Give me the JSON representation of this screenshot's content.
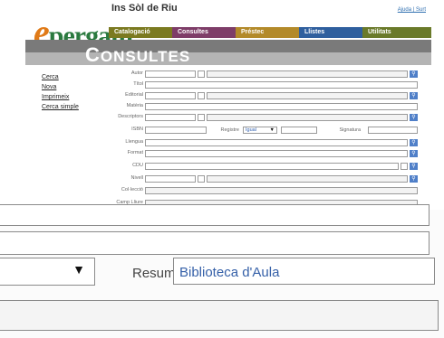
{
  "header": {
    "logo_text": "pergam",
    "logo_letter": "e",
    "school": "Ins Sòl de Riu",
    "links": "Ajuda | Surt"
  },
  "menu": [
    {
      "label": "Catalogació",
      "color": "#7b7a20"
    },
    {
      "label": "Consultes",
      "color": "#7e3d68"
    },
    {
      "label": "Préstec",
      "color": "#b38a2a"
    },
    {
      "label": "Llistes",
      "color": "#2f5f9e"
    },
    {
      "label": "Utilitats",
      "color": "#6a7a2a"
    }
  ],
  "page_title": "ONSULTES",
  "page_title_initial": "C",
  "sidebar": [
    "Cerca",
    "Nova",
    "Imprimeix",
    "Cerca simple"
  ],
  "form": {
    "autor": "Autor",
    "titol": "Títol",
    "editorial": "Editorial",
    "materia": "Matèria",
    "descriptors": "Descriptors",
    "isbn": "ISBN",
    "registre": "Registre",
    "registre_value": "Igual",
    "signatura": "Signatura",
    "llengua": "Llengua",
    "format": "Format",
    "cdu": "CDU",
    "nivell": "Nivell",
    "colleccio": "Col·lecció",
    "camp_lliure": "Camp Lliure"
  },
  "zoom": {
    "resum_label": "Resum",
    "resum_value": "Biblioteca d'Aula",
    "dropdown_arrow": "▼"
  }
}
